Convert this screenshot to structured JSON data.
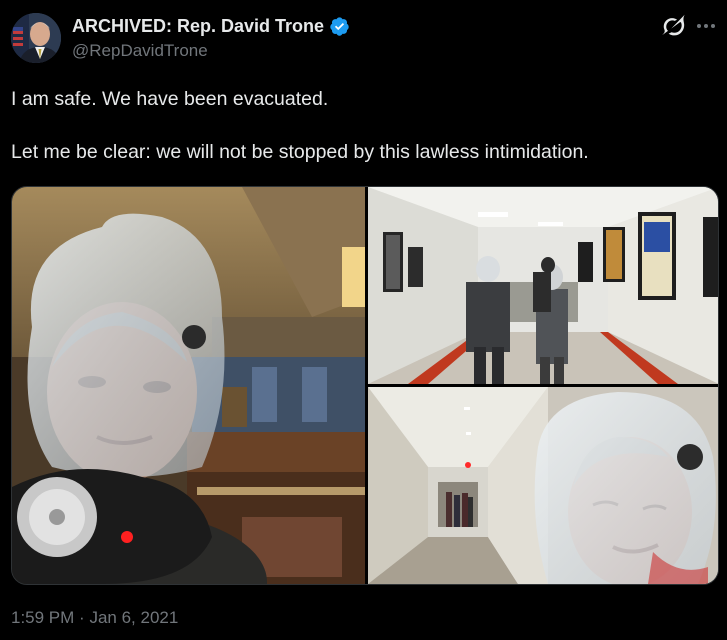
{
  "author": {
    "display_name": "ARCHIVED: Rep. David Trone",
    "handle": "@RepDavidTrone",
    "verified": true,
    "verified_color": "#1d9bf0"
  },
  "tweet": {
    "lines": [
      "I am safe. We have been evacuated.",
      "Let me be clear: we will not be stopped by this lawless intimidation."
    ],
    "time": "1:59 PM",
    "separator": "·",
    "date": "Jan 6, 2021"
  },
  "icons": {
    "grok": "grok-icon",
    "more": "more-icon"
  },
  "colors": {
    "background": "#000000",
    "text": "#e7e9ea",
    "secondary": "#71767b",
    "border": "#2f3336"
  }
}
